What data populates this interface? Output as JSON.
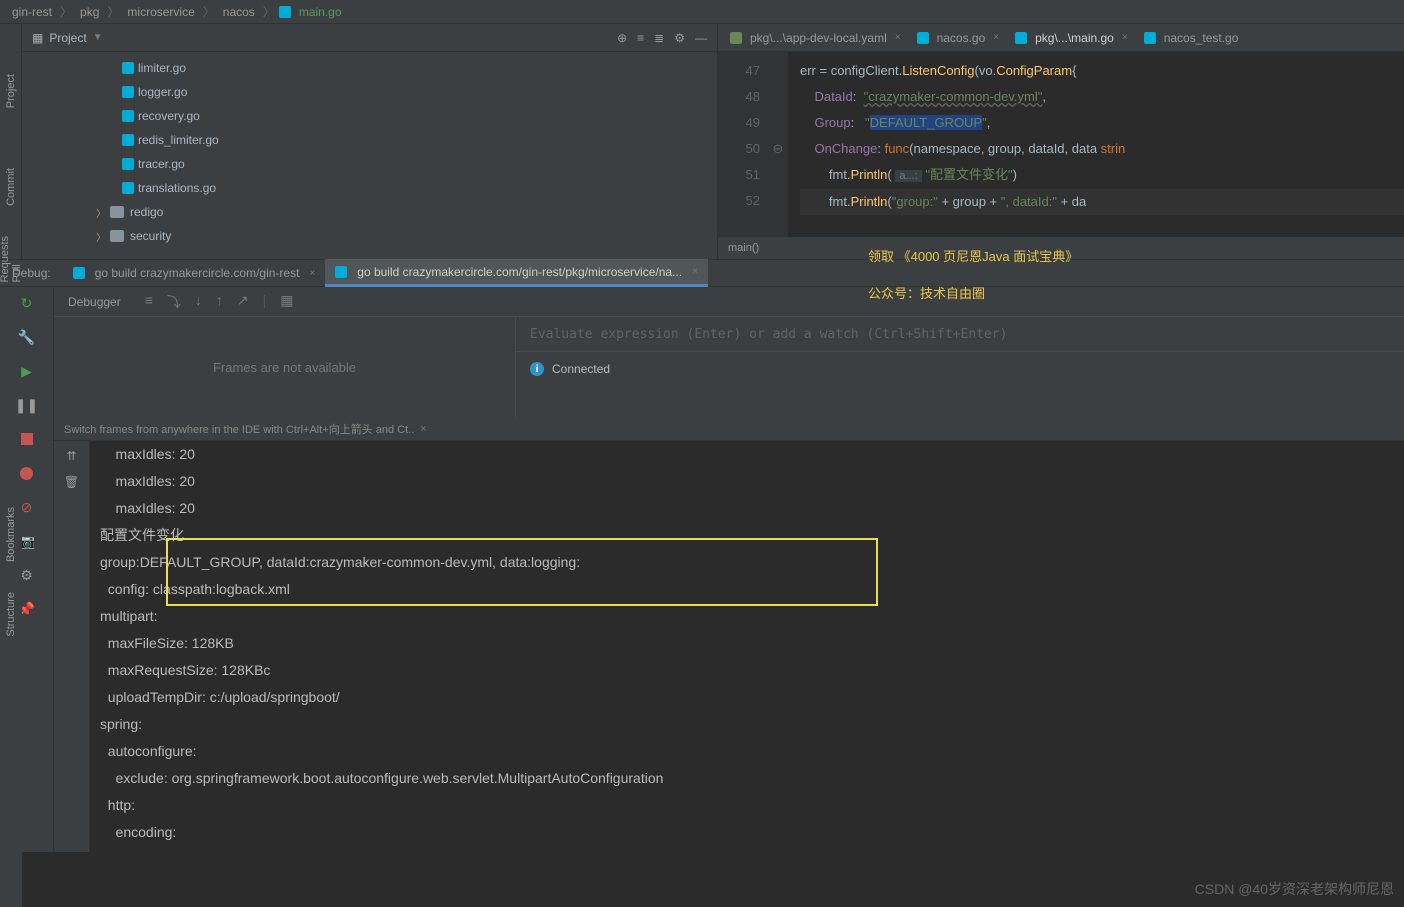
{
  "breadcrumb": [
    "gin-rest",
    "pkg",
    "microservice",
    "nacos",
    "main.go"
  ],
  "project": {
    "title": "Project",
    "files": [
      "limiter.go",
      "logger.go",
      "recovery.go",
      "redis_limiter.go",
      "tracer.go",
      "translations.go"
    ],
    "folders": [
      "redigo",
      "security"
    ]
  },
  "editor": {
    "tabs": [
      {
        "label": "pkg\\...\\app-dev-local.yaml",
        "active": false
      },
      {
        "label": "nacos.go",
        "active": false
      },
      {
        "label": "pkg\\...\\main.go",
        "active": true
      },
      {
        "label": "nacos_test.go",
        "active": false
      }
    ],
    "lines": {
      "47": {
        "text": "err = configClient.ListenConfig(vo.ConfigParam{"
      },
      "48": {
        "key": "DataId:",
        "str": "\"crazymaker-common-dev.yml\","
      },
      "49": {
        "key": "Group:",
        "str": "\"DEFAULT_GROUP\","
      },
      "50": {
        "key": "OnChange:",
        "fn": "func",
        "params": "(namespace, group, dataId, data strin"
      },
      "51": {
        "call": "fmt.Println(",
        "hint": "a...:",
        "str": " \"配置文件变化\")"
      },
      "52": {
        "call": "fmt.Println(",
        "rest": "\"group:\" + group + \", dataId:\" + da"
      }
    },
    "footer": "main()"
  },
  "overlay": {
    "line1": "领取 《4000 页尼恩Java 面试宝典》",
    "line2": "公众号：技术自由圈"
  },
  "debug": {
    "label": "Debug:",
    "tabs": [
      {
        "label": "go build crazymakercircle.com/gin-rest",
        "active": false
      },
      {
        "label": "go build crazymakercircle.com/gin-rest/pkg/microservice/na...",
        "active": true
      }
    ],
    "debugger": "Debugger",
    "frames": "Frames are not available",
    "eval_placeholder": "Evaluate expression (Enter) or add a watch (Ctrl+Shift+Enter)",
    "connected": "Connected",
    "hint": "Switch frames from anywhere in the IDE with Ctrl+Alt+向上箭头 and Ct.."
  },
  "console": [
    "    maxIdles: 20",
    "    maxIdles: 20",
    "",
    "    maxIdles: 20",
    "配置文件变化",
    "group:DEFAULT_GROUP, dataId:crazymaker-common-dev.yml, data:logging:",
    "  config: classpath:logback.xml",
    "multipart:",
    "  maxFileSize: 128KB",
    "  maxRequestSize: 128KBc",
    "  uploadTempDir: c:/upload/springboot/",
    "spring:",
    "  autoconfigure:",
    "    exclude: org.springframework.boot.autoconfigure.web.servlet.MultipartAutoConfiguration",
    "  http:",
    "    encoding:"
  ],
  "sidebars": {
    "left": [
      "Project",
      "Commit",
      "Pull Requests"
    ],
    "bottom_left": [
      "Bookmarks",
      "Structure"
    ]
  },
  "watermark": "CSDN @40岁资深老架构师尼恩"
}
